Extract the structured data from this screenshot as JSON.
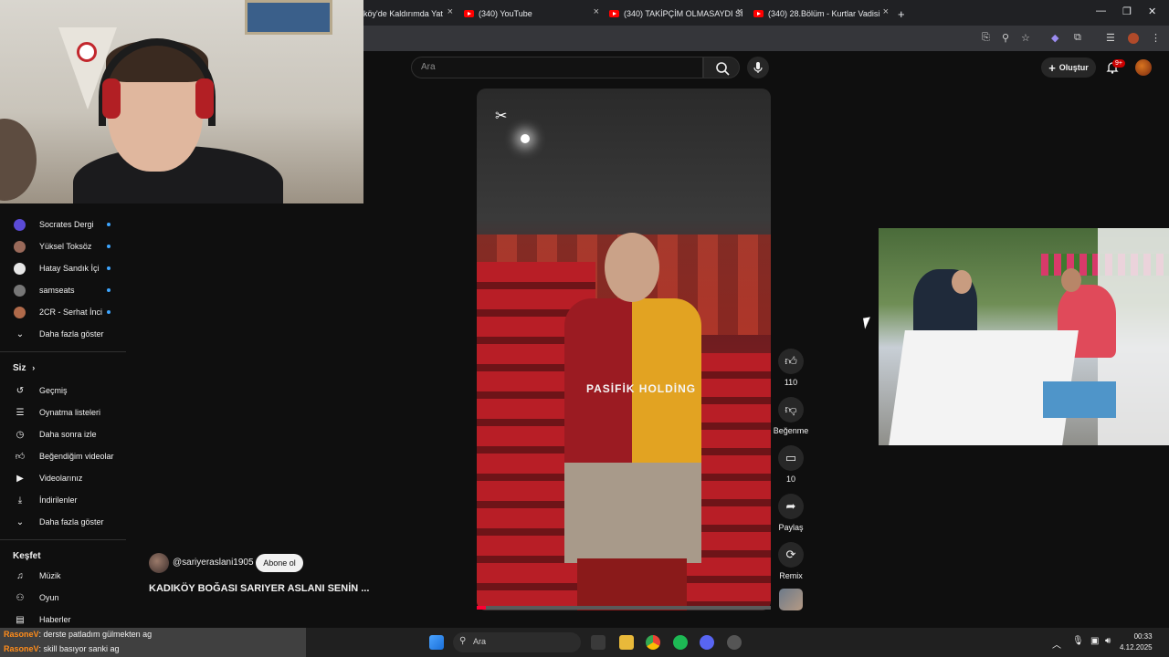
{
  "browser": {
    "tabs": [
      {
        "label": "köy'de Kaldırımda Yat"
      },
      {
        "label": "(340) YouTube"
      },
      {
        "label": "(340) TAKİPÇİM OLMASAYDI Sİ"
      },
      {
        "label": "(340) 28.Bölüm - Kurtlar Vadisi"
      }
    ],
    "new_tab": "+",
    "close_glyph": "×"
  },
  "header": {
    "search_placeholder": "Ara",
    "create_label": "Oluştur",
    "notification_count": "9+"
  },
  "sidebar": {
    "subscriptions": [
      {
        "name": "Socrates Dergi",
        "color": "#5b4bd6",
        "new": true
      },
      {
        "name": "Yüksel Toksöz",
        "color": "#9a6a5a",
        "new": true
      },
      {
        "name": "Hatay Sandık İçi",
        "color": "#e6e6e6",
        "new": true
      },
      {
        "name": "samseats",
        "color": "#777777",
        "new": true
      },
      {
        "name": "2CR - Serhat İnci",
        "color": "#b06a4a",
        "new": true
      }
    ],
    "show_more_1": "Daha fazla göster",
    "you_title": "Siz",
    "you_items": [
      {
        "label": "Geçmiş",
        "icon": "history-icon"
      },
      {
        "label": "Oynatma listeleri",
        "icon": "playlist-icon"
      },
      {
        "label": "Daha sonra izle",
        "icon": "clock-icon"
      },
      {
        "label": "Beğendiğim videolar",
        "icon": "thumbs-up-icon"
      },
      {
        "label": "Videolarınız",
        "icon": "video-icon"
      },
      {
        "label": "İndirilenler",
        "icon": "download-icon"
      }
    ],
    "show_more_2": "Daha fazla göster",
    "explore_title": "Keşfet",
    "explore_items": [
      {
        "label": "Müzik",
        "icon": "music-icon"
      },
      {
        "label": "Oyun",
        "icon": "gamepad-icon"
      },
      {
        "label": "Haberler",
        "icon": "news-icon"
      }
    ]
  },
  "short": {
    "channel": "@sariyeraslani1905",
    "subscribe_label": "Abone ol",
    "title": "KADIKÖY BOĞASI SARIYER ASLANI SENİN ...",
    "overlay_text": "PASİFİK HOLDİNG",
    "progress_fraction": 0.03,
    "actions": {
      "likes": "110",
      "dislike_label": "Beğenme",
      "comments": "10",
      "share_label": "Paylaş",
      "remix_label": "Remix"
    }
  },
  "chat": [
    {
      "user": "RasoneV",
      "message": ": derste patladım gülmekten ag"
    },
    {
      "user": "RasoneV",
      "message": ": skill basıyor sanki ag"
    }
  ],
  "taskbar": {
    "search_label": "Ara",
    "time": "00:33",
    "date": "4.12.2025"
  }
}
